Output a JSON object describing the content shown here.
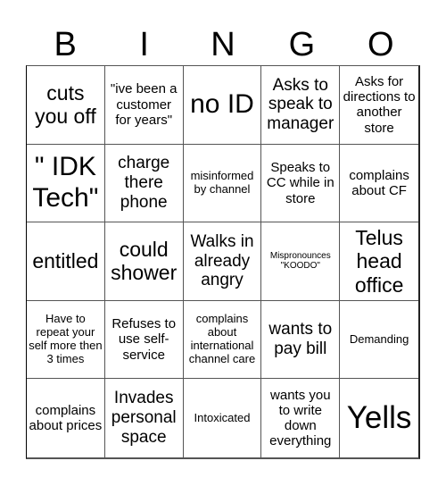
{
  "header": {
    "letters": [
      "B",
      "I",
      "N",
      "G",
      "O"
    ]
  },
  "cells": [
    {
      "text": "cuts you off",
      "size": "xl"
    },
    {
      "text": "\"ive been a customer for years\"",
      "size": "md"
    },
    {
      "text": "no ID",
      "size": "xxl"
    },
    {
      "text": "Asks to speak to manager",
      "size": "lg"
    },
    {
      "text": "Asks for directions to another store",
      "size": "md"
    },
    {
      "text": "\" IDK Tech\"",
      "size": "xxl"
    },
    {
      "text": "charge there phone",
      "size": "lg"
    },
    {
      "text": "misinformed by channel",
      "size": "sm"
    },
    {
      "text": "Speaks to CC while in store",
      "size": "md"
    },
    {
      "text": "complains about CF",
      "size": "md"
    },
    {
      "text": "entitled",
      "size": "xl"
    },
    {
      "text": "could shower",
      "size": "xl"
    },
    {
      "text": "Walks in already angry",
      "size": "lg"
    },
    {
      "text": "Mispronounces \"KOODO\"",
      "size": "xs"
    },
    {
      "text": "Telus head office",
      "size": "xl"
    },
    {
      "text": "Have to repeat your self more then 3 times",
      "size": "sm"
    },
    {
      "text": "Refuses to use self-service",
      "size": "md"
    },
    {
      "text": "complains about international channel care",
      "size": "sm"
    },
    {
      "text": "wants to pay bill",
      "size": "lg"
    },
    {
      "text": "Demanding",
      "size": "sm"
    },
    {
      "text": "complains about prices",
      "size": "md"
    },
    {
      "text": "Invades personal space",
      "size": "lg"
    },
    {
      "text": "Intoxicated",
      "size": "sm"
    },
    {
      "text": "wants you to write down everything",
      "size": "md"
    },
    {
      "text": "Yells",
      "size": "huge"
    }
  ]
}
